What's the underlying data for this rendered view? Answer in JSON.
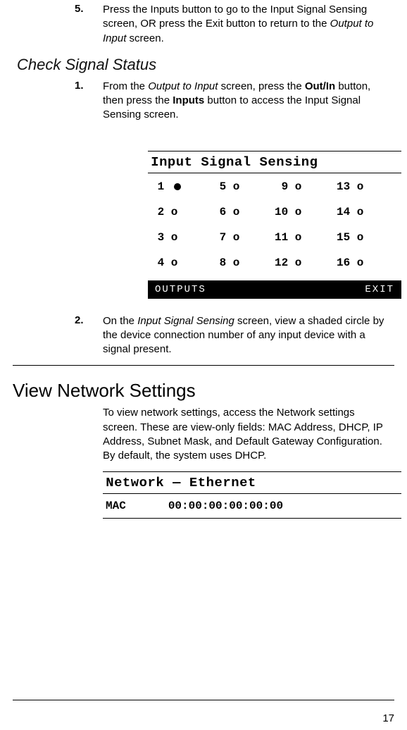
{
  "steps_top": {
    "num": "5.",
    "html": "Press the Inputs button to go to the Input Signal Sensing screen, OR press the Exit button to return to the <em>Output to Input</em> screen."
  },
  "check_signal": {
    "heading": "Check Signal Status",
    "step1_num": "1.",
    "step1_html": "From the <em>Output to Input</em> screen, press the <b>Out/In</b> button, then press the <b>Inputs</b> button to access the Input Signal Sensing screen.",
    "step2_num": "2.",
    "step2_html": "On the <em>Input Signal Sensing</em> screen, view a shaded circle by the device connection number of any input device with a signal present."
  },
  "lcd_sensing": {
    "title": "Input Signal Sensing",
    "cells": [
      {
        "n": "1",
        "state": "filled"
      },
      {
        "n": "5",
        "state": "o"
      },
      {
        "n": "9",
        "state": "o"
      },
      {
        "n": "13",
        "state": "o"
      },
      {
        "n": "2",
        "state": "o"
      },
      {
        "n": "6",
        "state": "o"
      },
      {
        "n": "10",
        "state": "o"
      },
      {
        "n": "14",
        "state": "o"
      },
      {
        "n": "3",
        "state": "o"
      },
      {
        "n": "7",
        "state": "o"
      },
      {
        "n": "11",
        "state": "o"
      },
      {
        "n": "15",
        "state": "o"
      },
      {
        "n": "4",
        "state": "o"
      },
      {
        "n": "8",
        "state": "o"
      },
      {
        "n": "12",
        "state": "o"
      },
      {
        "n": "16",
        "state": "o"
      }
    ],
    "bar_left": "OUTPUTS",
    "bar_right": "EXIT"
  },
  "view_network": {
    "heading": "View Network Settings",
    "para": "To view network settings, access the Network settings screen. These are view-only fields: MAC Address, DHCP, IP Address, Subnet Mask, and Default Gateway Configuration. By default, the system uses DHCP."
  },
  "lcd_net": {
    "title": "Network — Ethernet",
    "mac_label": "MAC",
    "mac_value": "00:00:00:00:00:00"
  },
  "page_number": "17"
}
